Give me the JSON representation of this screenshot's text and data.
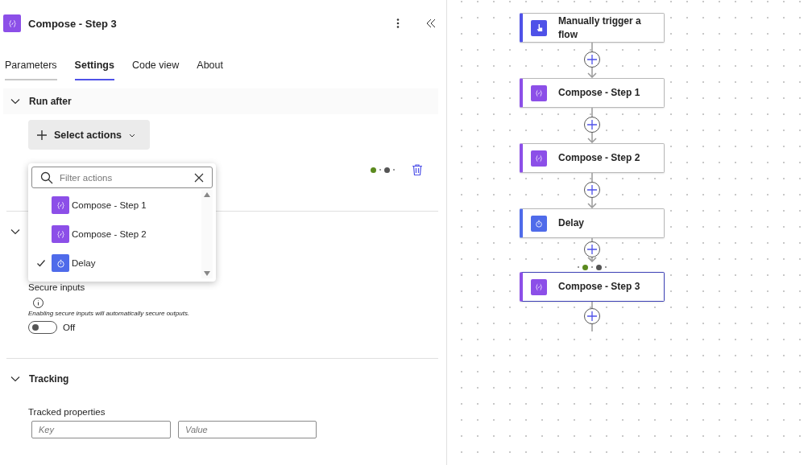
{
  "panel": {
    "title": "Compose - Step 3",
    "tabs": [
      {
        "label": "Parameters",
        "selected": false
      },
      {
        "label": "Settings",
        "selected": true
      },
      {
        "label": "Code view",
        "selected": false
      },
      {
        "label": "About",
        "selected": false
      }
    ],
    "run_after": {
      "title": "Run after",
      "expanded": true,
      "button": "Select actions",
      "statuses": [
        {
          "color": "#5b8a1e"
        },
        {
          "color": "#555555"
        }
      ]
    },
    "dropdown": {
      "placeholder": "Filter actions",
      "items": [
        {
          "kind": "compose",
          "label": "Compose - Step 1",
          "checked": false
        },
        {
          "kind": "compose",
          "label": "Compose - Step 2",
          "checked": false
        },
        {
          "kind": "delay",
          "label": "Delay",
          "checked": true
        }
      ]
    },
    "security": {
      "expanded": true,
      "label": "Secure inputs",
      "note": "Enabling secure inputs will automatically secure outputs.",
      "toggle": {
        "on": false,
        "label": "Off"
      }
    },
    "tracking": {
      "title": "Tracking",
      "expanded": true,
      "label": "Tracked properties",
      "key_placeholder": "Key",
      "value_placeholder": "Value"
    }
  },
  "flow": {
    "nodes": [
      {
        "kind": "trigger",
        "label": "Manually trigger a flow",
        "selected": false
      },
      {
        "kind": "compose",
        "label": "Compose - Step 1",
        "selected": false
      },
      {
        "kind": "compose",
        "label": "Compose - Step 2",
        "selected": false
      },
      {
        "kind": "delay",
        "label": "Delay",
        "selected": false
      },
      {
        "kind": "compose",
        "label": "Compose - Step 3",
        "selected": true
      }
    ],
    "run_after_statuses": [
      {
        "color": "#5b8a1e"
      },
      {
        "color": "#555555"
      }
    ]
  }
}
